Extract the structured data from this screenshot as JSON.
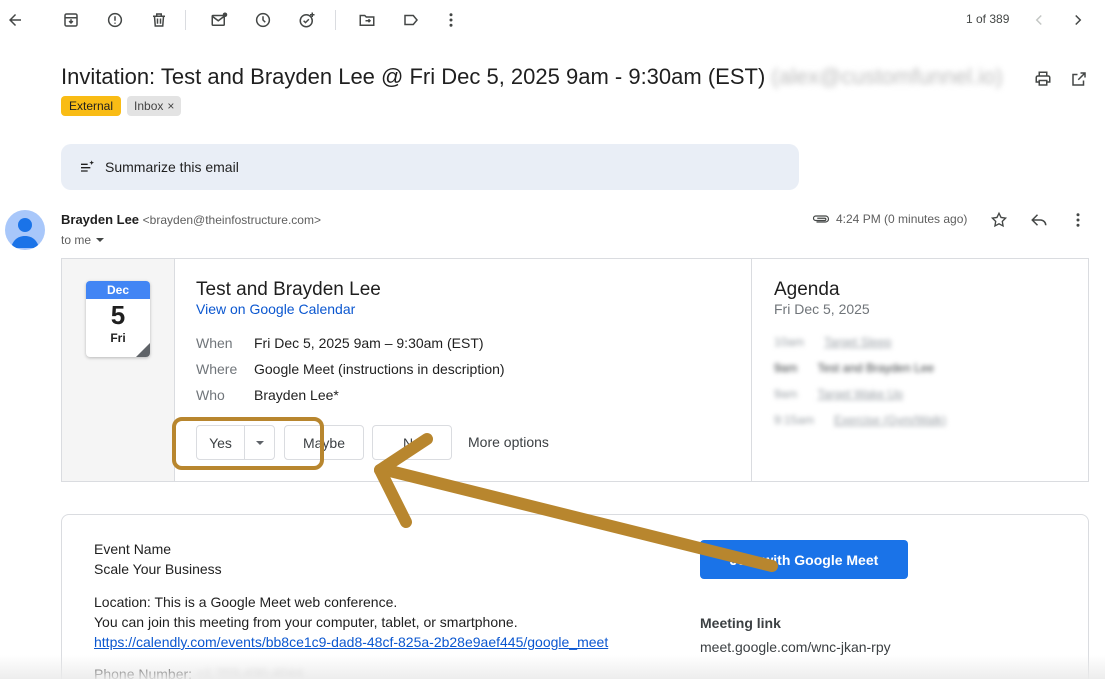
{
  "toolbar": {
    "back_icon": "arrow-left-icon",
    "archive_icon": "archive-icon",
    "report_spam_icon": "report-icon",
    "delete_icon": "trash-icon",
    "mark_unread_icon": "mail-unread-icon",
    "snooze_icon": "clock-icon",
    "add_task_icon": "add-task-icon",
    "move_to_icon": "folder-move-icon",
    "labels_icon": "label-icon",
    "more_icon": "more-vert-icon",
    "pager": "1 of 389"
  },
  "email": {
    "subject": "Invitation: Test and Brayden Lee @ Fri Dec 5, 2025 9am - 9:30am (EST)",
    "subject_redacted": "(alex@customfunnel.io)",
    "labels": {
      "external": "External",
      "inbox": "Inbox",
      "inbox_remove": "×"
    },
    "summarize": "Summarize this email",
    "sender_name": "Brayden Lee",
    "sender_email": "<brayden@theinfostructure.com>",
    "to": "to me",
    "time": "4:24 PM (0 minutes ago)"
  },
  "invite": {
    "cal_month": "Dec",
    "cal_day": "5",
    "cal_weekday": "Fri",
    "title": "Test and Brayden Lee",
    "view_link": "View on Google Calendar",
    "when_label": "When",
    "when_value": "Fri Dec 5, 2025 9am – 9:30am (EST)",
    "where_label": "Where",
    "where_value": "Google Meet (instructions in description)",
    "who_label": "Who",
    "who_value": "Brayden Lee*",
    "rsvp_yes": "Yes",
    "rsvp_maybe": "Maybe",
    "rsvp_no": "No",
    "more_options": "More options"
  },
  "agenda": {
    "title": "Agenda",
    "date": "Fri Dec 5, 2025",
    "items": [
      {
        "time": "10am",
        "event": "Target Sleep"
      },
      {
        "time": "9am",
        "event": "Test and Brayden Lee"
      },
      {
        "time": "9am",
        "event": "Target Wake Up"
      },
      {
        "time": "9:15am",
        "event": "Exercise (Gym/Walk)"
      }
    ]
  },
  "body": {
    "event_name_label": "Event Name",
    "event_name_value": "Scale Your Business",
    "location_line": "Location: This is a Google Meet web conference.",
    "join_line": "You can join this meeting from your computer, tablet, or smartphone.",
    "calendly_link": "https://calendly.com/events/bb8ce1c9-dad8-48cf-825a-2b28e9aef445/google_meet",
    "phone_label": "Phone Number:",
    "phone_redacted": "+1 703-430-4044",
    "join_button": "Join with Google Meet",
    "meeting_link_label": "Meeting link",
    "meeting_link_value": "meet.google.com/wnc-jkan-rpy"
  },
  "colors": {
    "external_label": "#f9bc15",
    "highlight": "#b8862e",
    "join_button": "#1a73e8",
    "link": "#0b57d0",
    "calendar_header": "#4285f4"
  }
}
